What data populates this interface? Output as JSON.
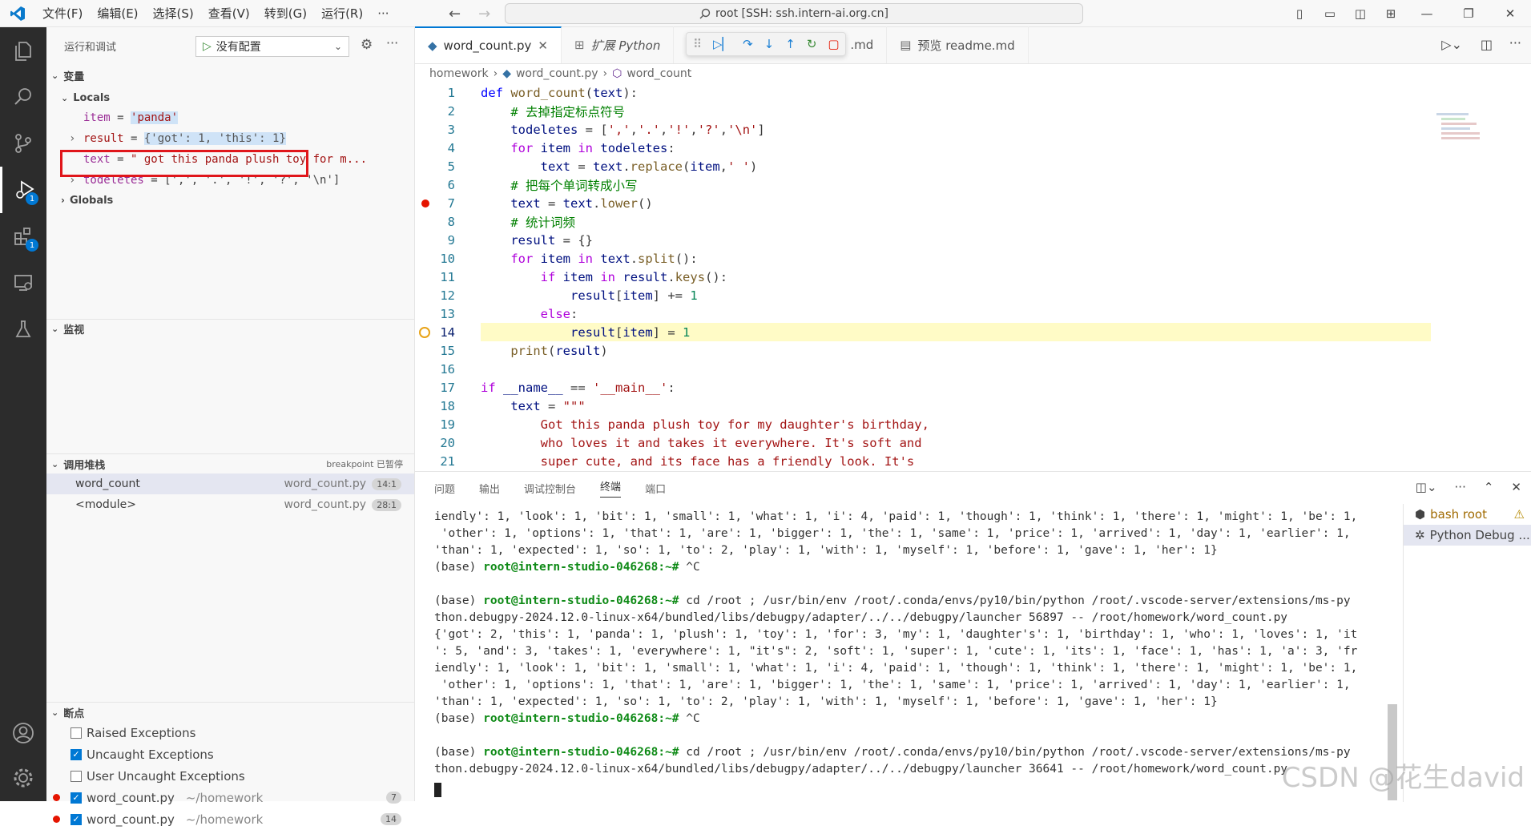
{
  "titlebar": {
    "menus": [
      "文件(F)",
      "编辑(E)",
      "选择(S)",
      "查看(V)",
      "转到(G)",
      "运行(R)",
      "···"
    ],
    "search_text": "root [SSH: ssh.intern-ai.org.cn]"
  },
  "activity": {
    "debug_badge": "1",
    "extensions_badge": "1"
  },
  "sidebar": {
    "header": "运行和调试",
    "config": "没有配置",
    "variables_title": "变量",
    "locals_title": "Locals",
    "locals": [
      {
        "name": "item",
        "value": "'panda'"
      },
      {
        "name": "result",
        "value": "{'got': 1, 'this': 1}"
      },
      {
        "name": "text",
        "value": "\"          got this panda plush toy for m..."
      },
      {
        "name": "todeletes",
        "value": "[',', '.', '!', '?', '\\n']"
      }
    ],
    "globals_title": "Globals",
    "watch_title": "监视",
    "callstack_title": "调用堆栈",
    "callstack_status": "breakpoint 已暂停",
    "callstack": [
      {
        "name": "word_count",
        "file": "word_count.py",
        "pos": "14:1"
      },
      {
        "name": "<module>",
        "file": "word_count.py",
        "pos": "28:1"
      }
    ],
    "breakpoints_title": "断点",
    "breakpoints": [
      {
        "label": "Raised Exceptions",
        "checked": false
      },
      {
        "label": "Uncaught Exceptions",
        "checked": true
      },
      {
        "label": "User Uncaught Exceptions",
        "checked": false
      },
      {
        "label": "word_count.py",
        "path": "~/homework",
        "line": "7",
        "checked": true
      },
      {
        "label": "word_count.py",
        "path": "~/homework",
        "line": "14",
        "checked": true
      }
    ]
  },
  "editor": {
    "tabs": [
      "word_count.py",
      "扩展 Python",
      ".md",
      "预览 readme.md"
    ],
    "breadcrumb": [
      "homework",
      "word_count.py",
      "word_count"
    ],
    "line_numbers": [
      "1",
      "2",
      "3",
      "4",
      "5",
      "6",
      "7",
      "8",
      "9",
      "10",
      "11",
      "12",
      "13",
      "14",
      "15",
      "16",
      "17",
      "18",
      "19",
      "20",
      "21"
    ]
  },
  "panel": {
    "tabs": [
      "问题",
      "输出",
      "调试控制台",
      "终端",
      "端口"
    ],
    "prompt": "root@intern-studio-046268:~#",
    "terminal_lines": [
      "iendly': 1, 'look': 1, 'bit': 1, 'small': 1, 'what': 1, 'i': 4, 'paid': 1, 'though': 1, 'think': 1, 'there': 1, 'might': 1, 'be': 1,",
      " 'other': 1, 'options': 1, 'that': 1, 'are': 1, 'bigger': 1, 'the': 1, 'same': 1, 'price': 1, 'arrived': 1, 'day': 1, 'earlier': 1,",
      "'than': 1, 'expected': 1, 'so': 1, 'to': 2, 'play': 1, 'with': 1, 'myself': 1, 'before': 1, 'gave': 1, 'her': 1}",
      "",
      "",
      "thon.debugpy-2024.12.0-linux-x64/bundled/libs/debugpy/adapter/../../debugpy/launcher 56897 -- /root/homework/word_count.py",
      "{'got': 2, 'this': 1, 'panda': 1, 'plush': 1, 'toy': 1, 'for': 3, 'my': 1, 'daughter's': 1, 'birthday': 1, 'who': 1, 'loves': 1, 'it",
      "': 5, 'and': 3, 'takes': 1, 'everywhere': 1, \"it's\": 2, 'soft': 1, 'super': 1, 'cute': 1, 'its': 1, 'face': 1, 'has': 1, 'a': 3, 'fr",
      "iendly': 1, 'look': 1, 'bit': 1, 'small': 1, 'what': 1, 'i': 4, 'paid': 1, 'though': 1, 'think': 1, 'there': 1, 'might': 1, 'be': 1,",
      " 'other': 1, 'options': 1, 'that': 1, 'are': 1, 'bigger': 1, 'the': 1, 'same': 1, 'price': 1, 'arrived': 1, 'day': 1, 'earlier': 1,",
      "'than': 1, 'expected': 1, 'so': 1, 'to': 2, 'play': 1, 'with': 1, 'myself': 1, 'before': 1, 'gave': 1, 'her': 1}",
      "",
      "",
      "thon.debugpy-2024.12.0-linux-x64/bundled/libs/debugpy/adapter/../../debugpy/launcher 36641 -- /root/homework/word_count.py"
    ],
    "cmd1": " cd /root ; /usr/bin/env /root/.conda/envs/py10/bin/python /root/.vscode-server/extensions/ms-py",
    "cmd2": " cd /root ; /usr/bin/env /root/.conda/envs/py10/bin/python /root/.vscode-server/extensions/ms-py",
    "ctrl_c": " ^C",
    "base": "(base) ",
    "terminals": [
      "bash  root",
      "Python Debug ..."
    ],
    "watermark": "CSDN @花生david"
  }
}
